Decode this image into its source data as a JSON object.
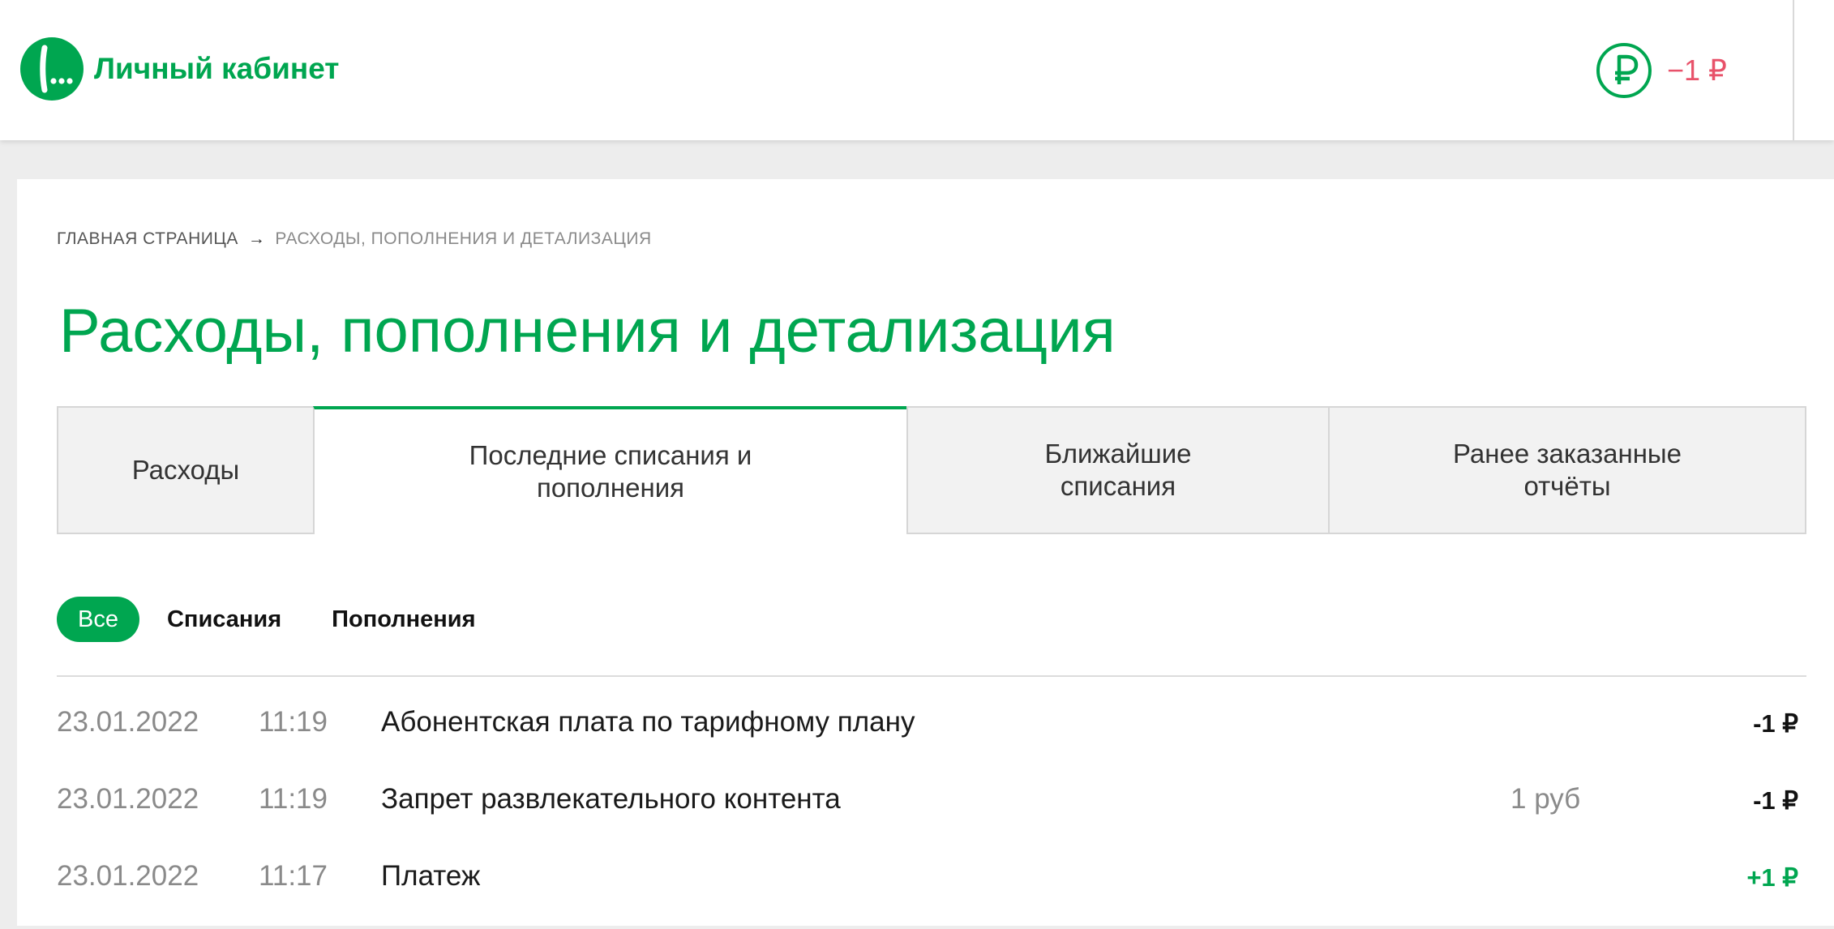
{
  "header": {
    "brand_title": "Личный кабинет",
    "balance": "−1 ₽",
    "colors": {
      "brand": "#00a650",
      "negative": "#e8526a"
    },
    "icons": [
      "megafon-logo-icon",
      "ruble-icon"
    ]
  },
  "breadcrumb": {
    "home": "ГЛАВНАЯ СТРАНИЦА",
    "separator": "→",
    "current": "РАСХОДЫ, ПОПОЛНЕНИЯ И ДЕТАЛИЗАЦИЯ"
  },
  "page_title": "Расходы, пополнения и детализация",
  "tabs": [
    {
      "label": "Расходы",
      "active": false
    },
    {
      "label": "Последние списания и пополнения",
      "active": true
    },
    {
      "label": "Ближайшие списания",
      "active": false
    },
    {
      "label": "Ранее заказанные отчёты",
      "active": false
    }
  ],
  "filters": {
    "all": "Все",
    "charges": "Списания",
    "topups": "Пополнения",
    "selected": "Все"
  },
  "transactions": [
    {
      "date": "23.01.2022",
      "time": "11:19",
      "description": "Абонентская плата по тарифному плану",
      "note": "",
      "amount": "-1 ₽",
      "type": "charge"
    },
    {
      "date": "23.01.2022",
      "time": "11:19",
      "description": "Запрет развлекательного контента",
      "note": "1 руб",
      "amount": "-1 ₽",
      "type": "charge"
    },
    {
      "date": "23.01.2022",
      "time": "11:17",
      "description": "Платеж",
      "note": "",
      "amount": "+1 ₽",
      "type": "payment"
    }
  ]
}
